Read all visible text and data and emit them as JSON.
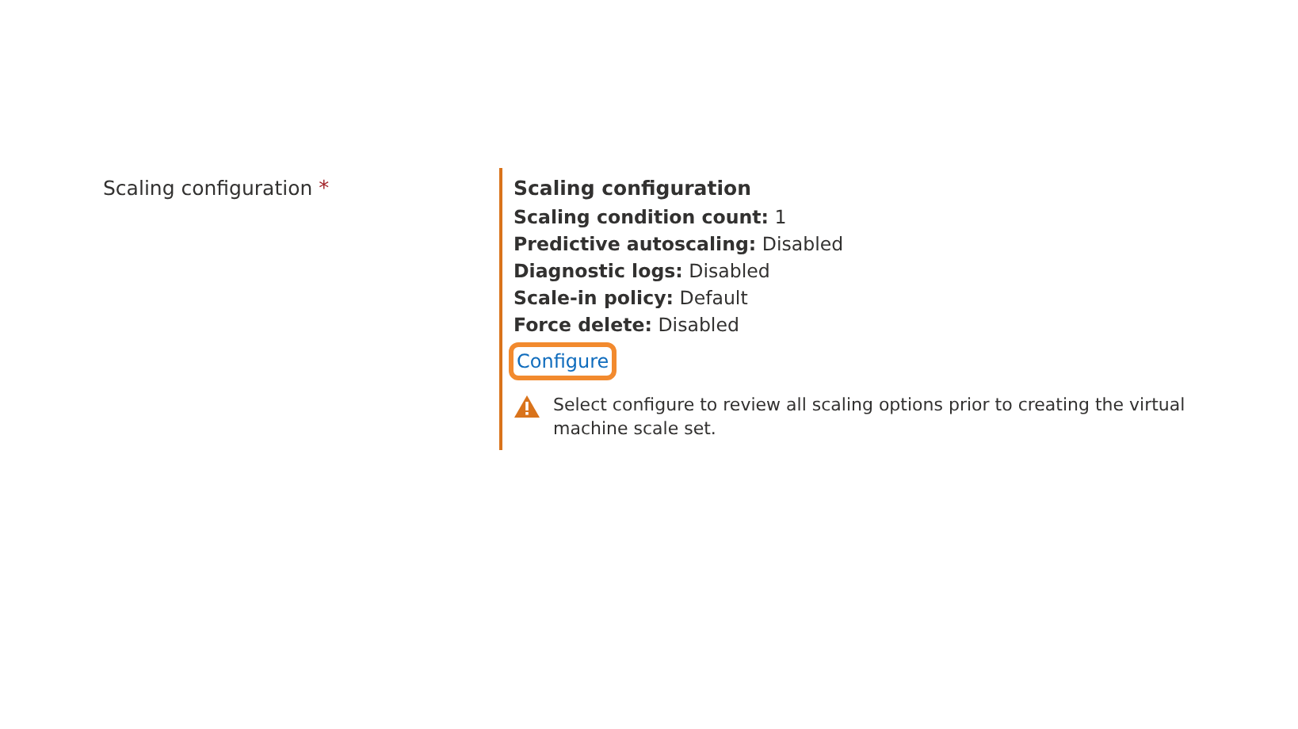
{
  "field": {
    "label": "Scaling configuration",
    "required_mark": "*"
  },
  "summary": {
    "title": "Scaling configuration",
    "items": [
      {
        "name": "Scaling condition count:",
        "value": "1"
      },
      {
        "name": "Predictive autoscaling:",
        "value": "Disabled"
      },
      {
        "name": "Diagnostic logs:",
        "value": "Disabled"
      },
      {
        "name": "Scale-in policy:",
        "value": "Default"
      },
      {
        "name": "Force delete:",
        "value": "Disabled"
      }
    ],
    "link": {
      "label": "Configure",
      "highlighted": true
    },
    "warning": {
      "kind": "warning",
      "text": "Select configure to review all scaling options prior to creating the virtual machine scale set."
    }
  }
}
